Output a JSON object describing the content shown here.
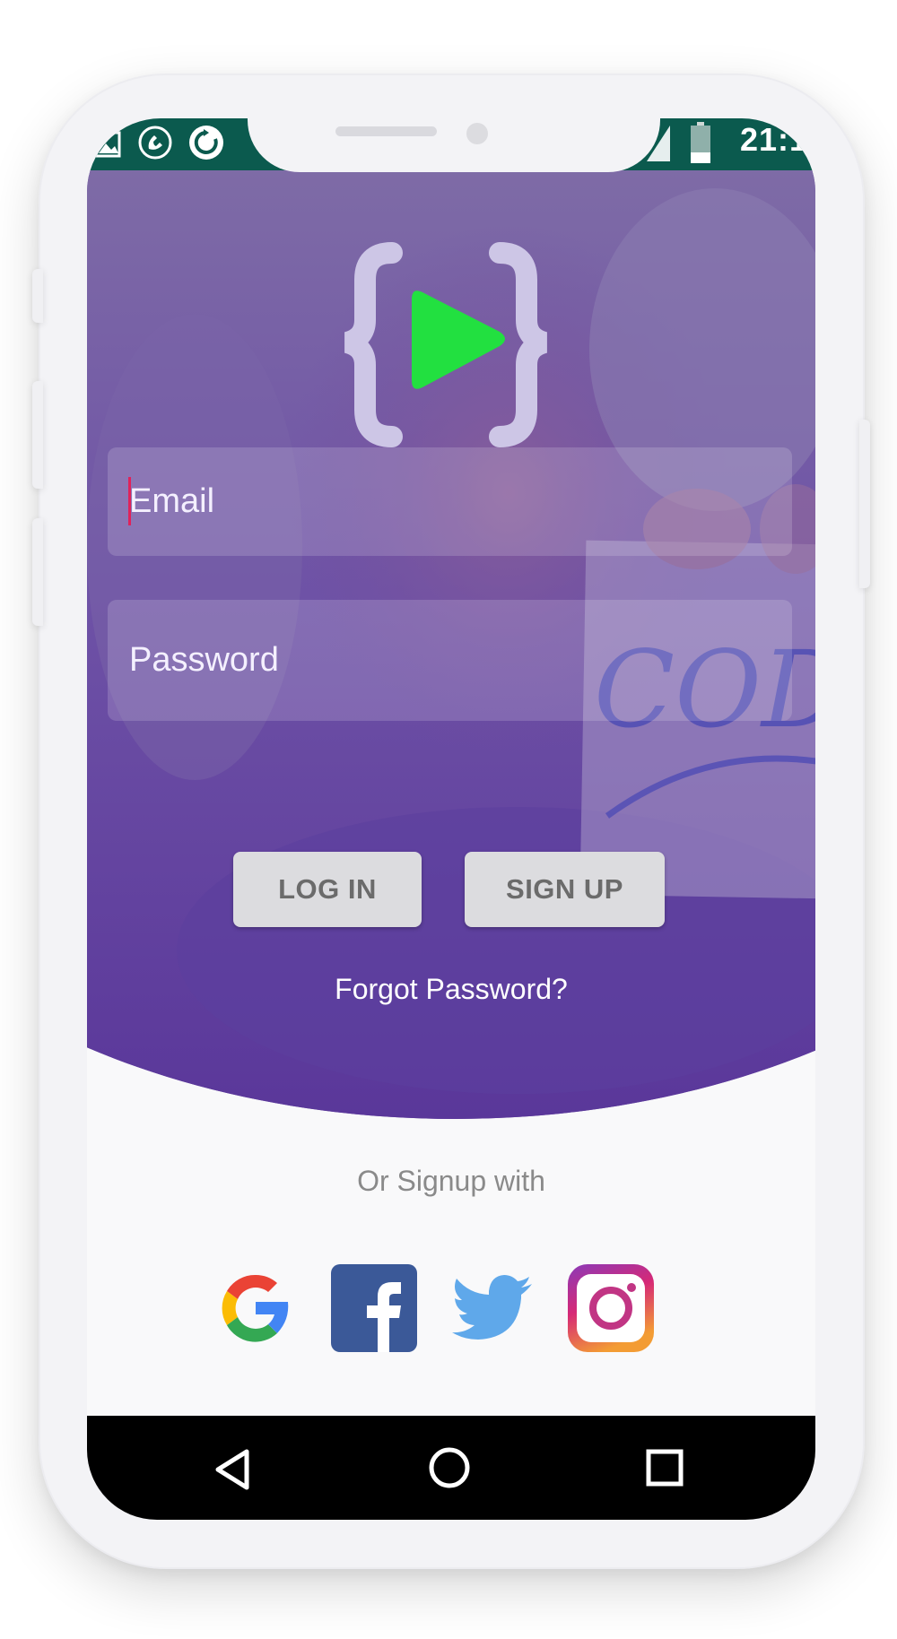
{
  "status_bar": {
    "time": "21:1",
    "background_color": "#0b5a4e",
    "left_icons": [
      "image-icon",
      "phone-call-icon",
      "sync-icon"
    ],
    "right_icons": [
      "signal-icon",
      "battery-icon"
    ]
  },
  "logo": {
    "icon": "code-play-logo",
    "accent_color": "#22e040"
  },
  "form": {
    "email_placeholder": "Email",
    "password_placeholder": "Password",
    "login_label": "LOG IN",
    "signup_label": "SIGN UP",
    "forgot_label": "Forgot Password?"
  },
  "social": {
    "prompt": "Or Signup with",
    "providers": [
      "google-icon",
      "facebook-icon",
      "twitter-icon",
      "instagram-icon"
    ]
  },
  "navbar": {
    "buttons": [
      "back-icon",
      "home-icon",
      "recents-icon"
    ]
  },
  "colors": {
    "hero_overlay": "#6a4aa6",
    "button_bg": "#dcdcdf",
    "screen_bg": "#f9f9fa"
  }
}
